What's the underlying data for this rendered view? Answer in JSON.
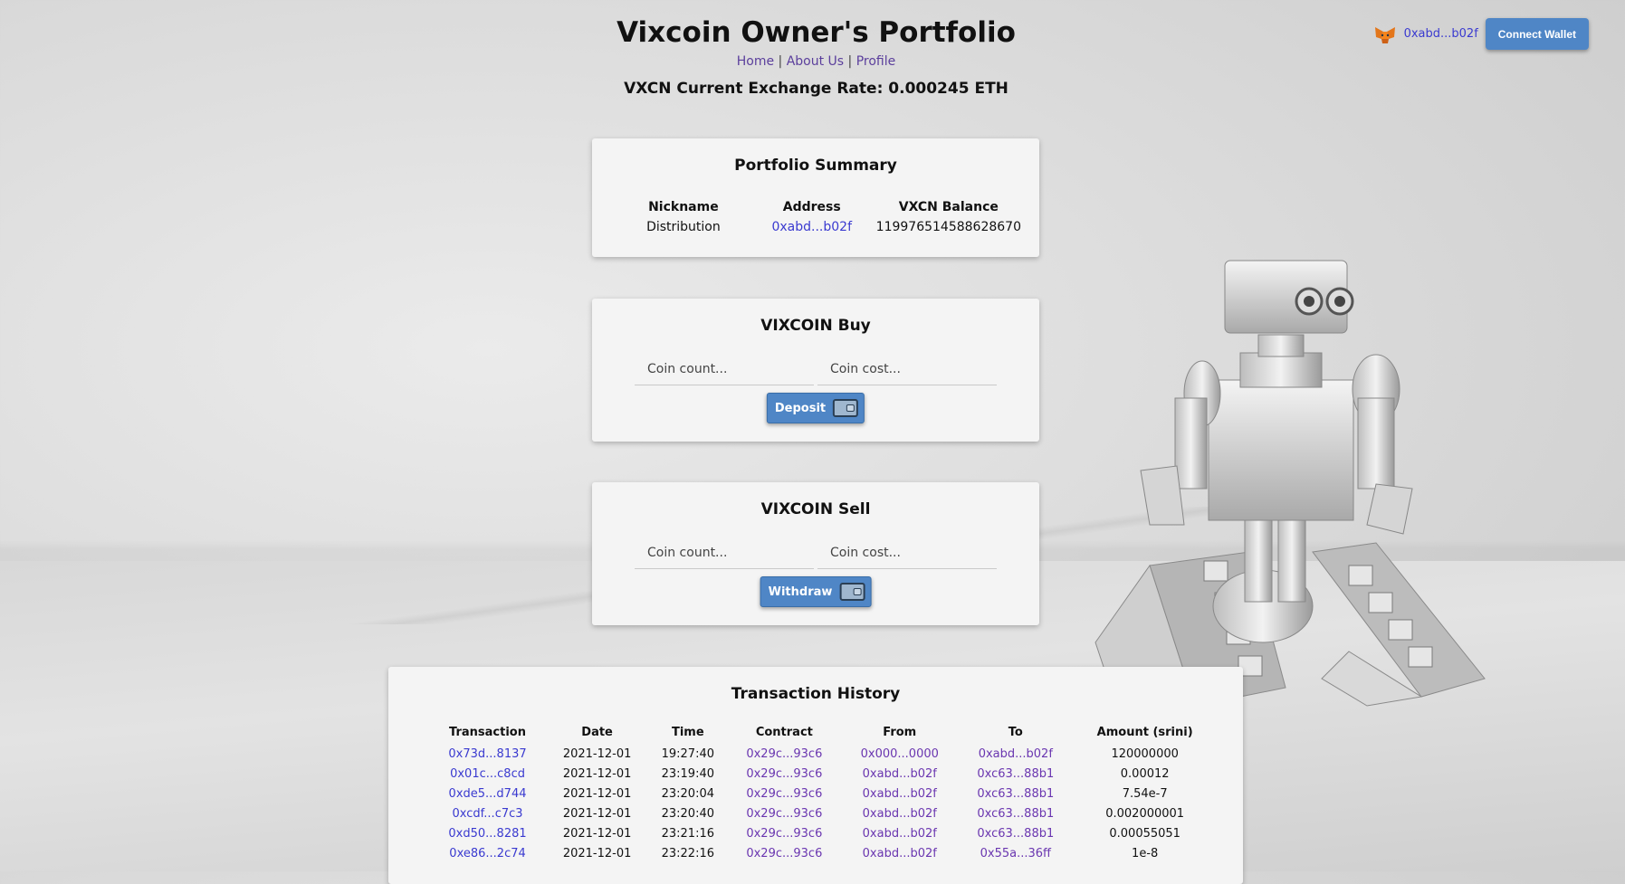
{
  "header": {
    "title": "Vixcoin Owner's Portfolio",
    "nav": [
      "Home",
      "About Us",
      "Profile"
    ],
    "nav_separator": "|",
    "exchange_rate": "VXCN Current Exchange Rate: 0.000245 ETH"
  },
  "wallet": {
    "address": "0xabd...b02f",
    "connect_label": "Connect Wallet",
    "logo_icon": "metamask-fox-icon"
  },
  "summary": {
    "title": "Portfolio Summary",
    "headers": [
      "Nickname",
      "Address",
      "VXCN Balance"
    ],
    "nickname": "Distribution",
    "address": "0xabd...b02f",
    "balance": "119976514588628670"
  },
  "buy": {
    "title": "VIXCOIN Buy",
    "count_placeholder": "Coin count...",
    "cost_placeholder": "Coin cost...",
    "button_label": "Deposit",
    "button_icon": "wallet-icon"
  },
  "sell": {
    "title": "VIXCOIN Sell",
    "count_placeholder": "Coin count...",
    "cost_placeholder": "Coin cost...",
    "button_label": "Withdraw",
    "button_icon": "wallet-icon"
  },
  "history": {
    "title": "Transaction History",
    "headers": [
      "Transaction",
      "Date",
      "Time",
      "Contract",
      "From",
      "To",
      "Amount (srini)"
    ],
    "rows": [
      [
        "0x73d...8137",
        "2021-12-01",
        "19:27:40",
        "0x29c...93c6",
        "0x000...0000",
        "0xabd...b02f",
        "120000000"
      ],
      [
        "0x01c...c8cd",
        "2021-12-01",
        "23:19:40",
        "0x29c...93c6",
        "0xabd...b02f",
        "0xc63...88b1",
        "0.00012"
      ],
      [
        "0xde5...d744",
        "2021-12-01",
        "23:20:04",
        "0x29c...93c6",
        "0xabd...b02f",
        "0xc63...88b1",
        "7.54e-7"
      ],
      [
        "0xcdf...c7c3",
        "2021-12-01",
        "23:20:40",
        "0x29c...93c6",
        "0xabd...b02f",
        "0xc63...88b1",
        "0.002000001"
      ],
      [
        "0xd50...8281",
        "2021-12-01",
        "23:21:16",
        "0x29c...93c6",
        "0xabd...b02f",
        "0xc63...88b1",
        "0.00055051"
      ],
      [
        "0xe86...2c74",
        "2021-12-01",
        "23:22:16",
        "0x29c...93c6",
        "0xabd...b02f",
        "0x55a...36ff",
        "1e-8"
      ]
    ]
  }
}
